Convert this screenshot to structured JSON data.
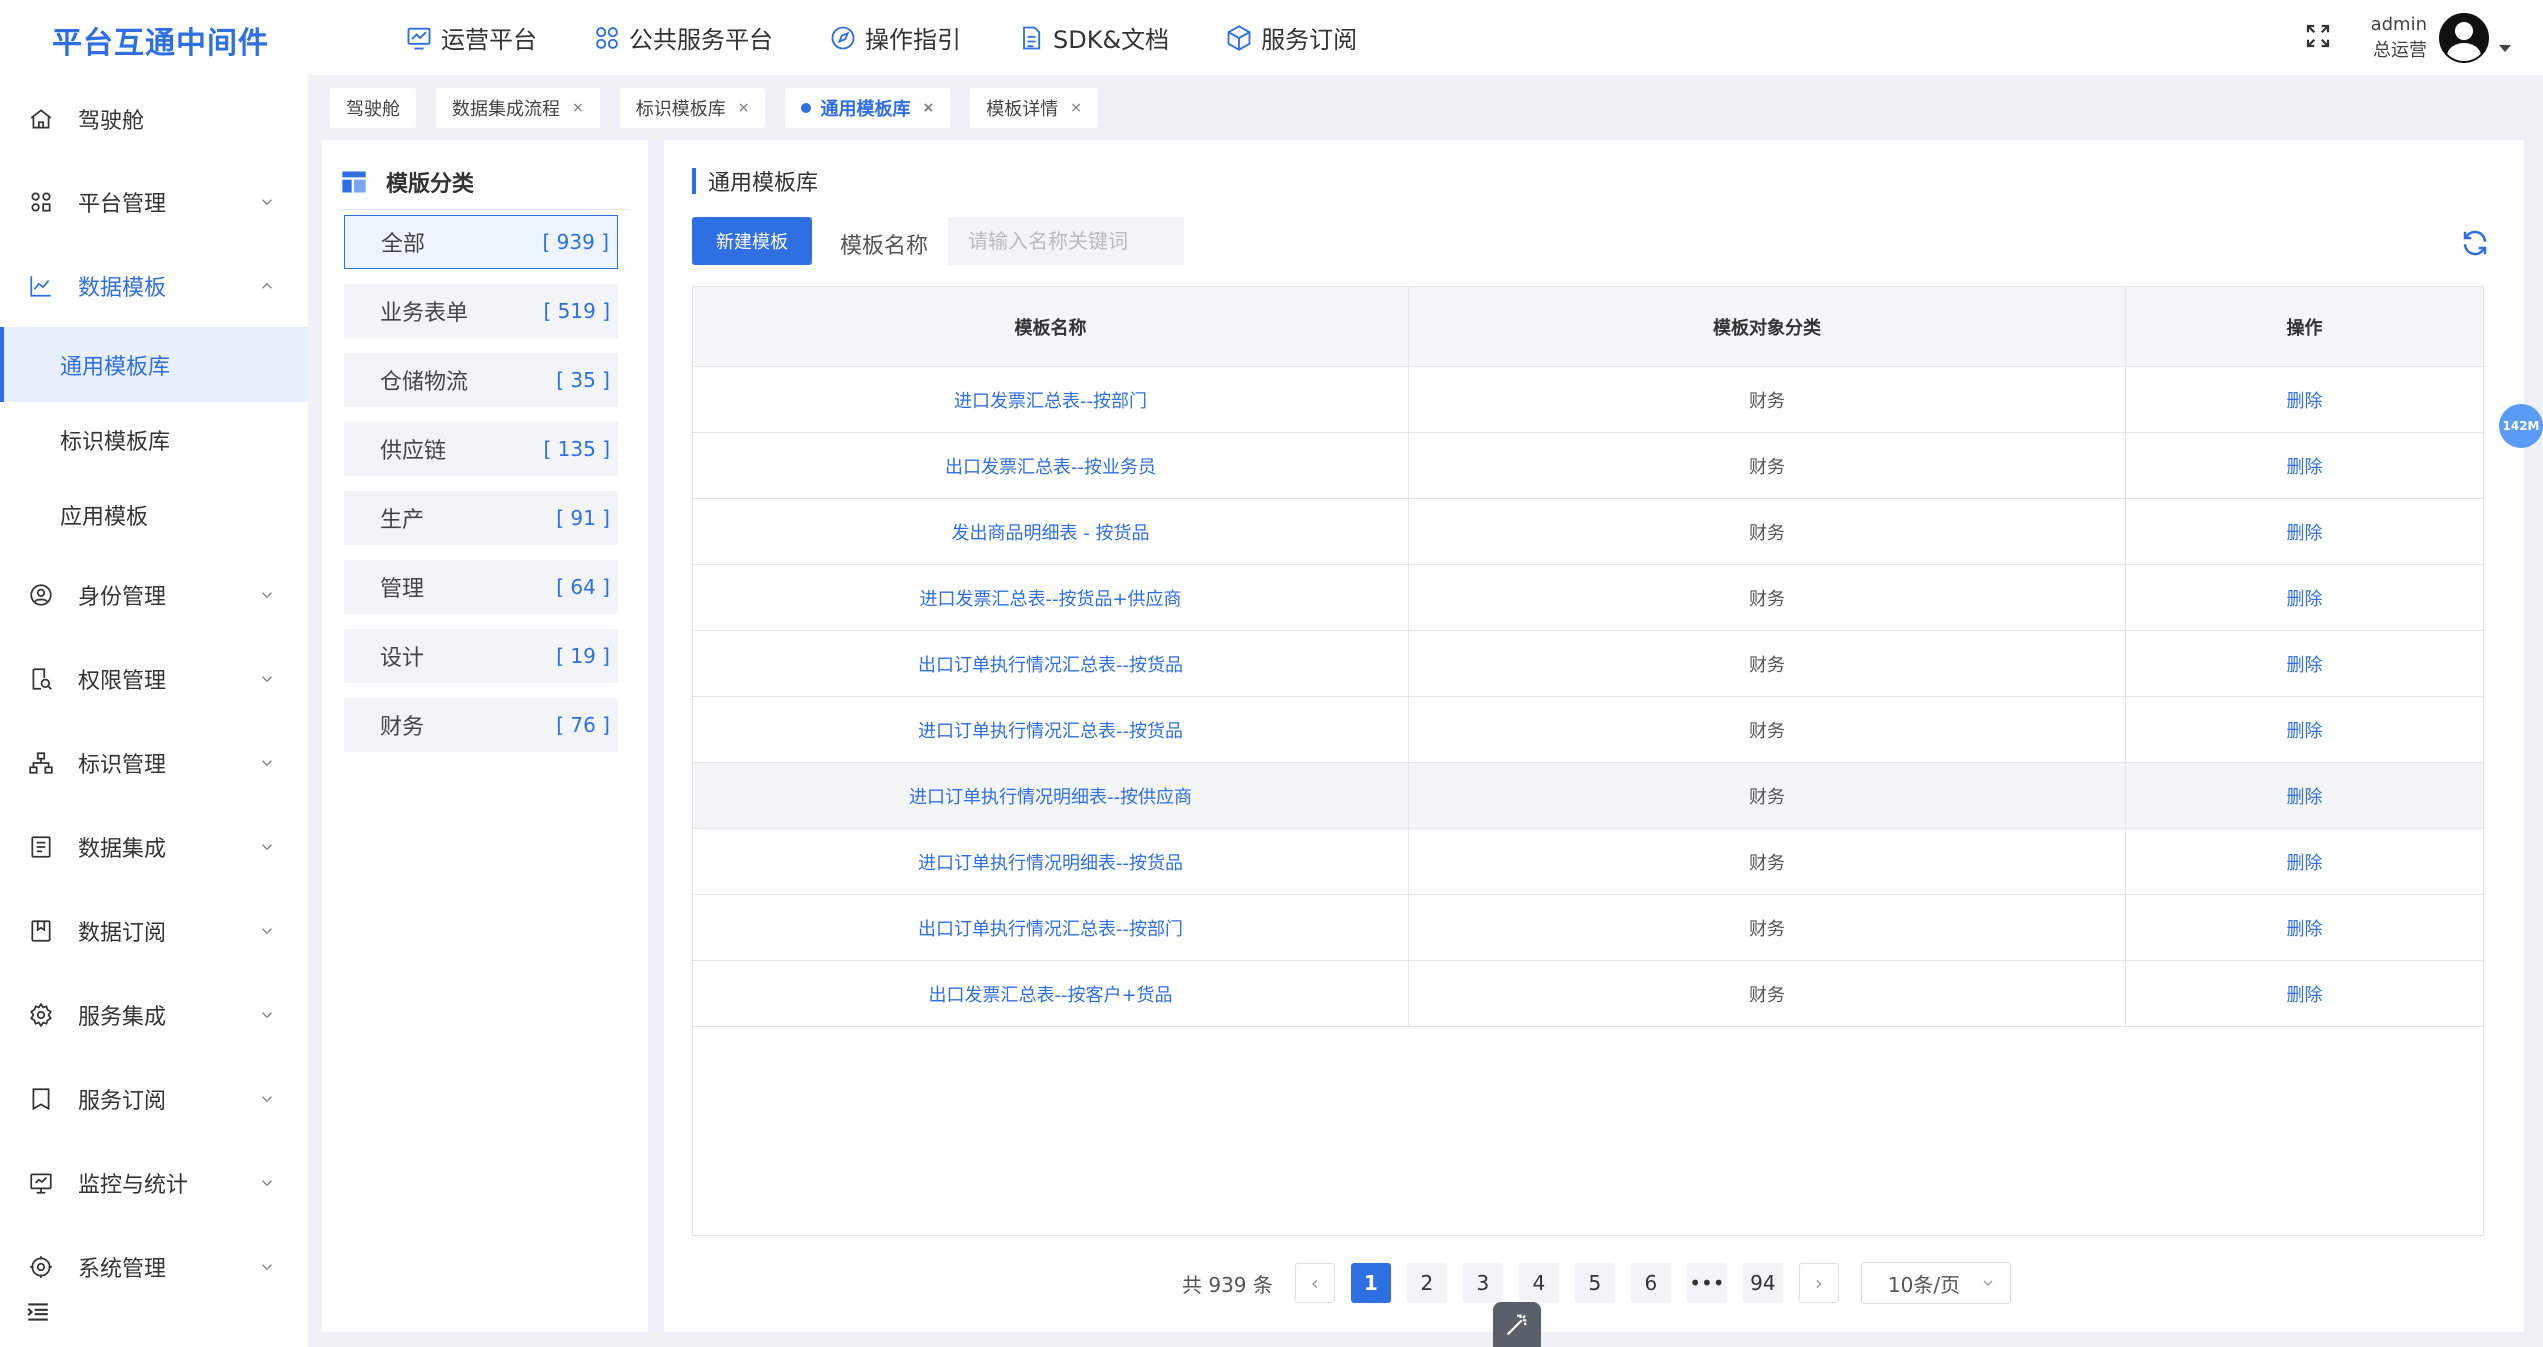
{
  "app": {
    "title": "平台互通中间件"
  },
  "topnav": [
    {
      "label": "运营平台",
      "icon": "monitor-chart-icon"
    },
    {
      "label": "公共服务平台",
      "icon": "grid-icon"
    },
    {
      "label": "操作指引",
      "icon": "compass-icon"
    },
    {
      "label": "SDK&文档",
      "icon": "document-icon"
    },
    {
      "label": "服务订阅",
      "icon": "cube-icon"
    }
  ],
  "user": {
    "name": "admin",
    "role": "总运营"
  },
  "sidebar": {
    "items": [
      {
        "label": "驾驶舱"
      },
      {
        "label": "平台管理"
      },
      {
        "label": "数据模板"
      },
      {
        "label": "身份管理"
      },
      {
        "label": "权限管理"
      },
      {
        "label": "标识管理"
      },
      {
        "label": "数据集成"
      },
      {
        "label": "数据订阅"
      },
      {
        "label": "服务集成"
      },
      {
        "label": "服务订阅"
      },
      {
        "label": "监控与统计"
      },
      {
        "label": "系统管理"
      }
    ],
    "sub": [
      {
        "label": "通用模板库"
      },
      {
        "label": "标识模板库"
      },
      {
        "label": "应用模板"
      }
    ]
  },
  "tabs": [
    {
      "label": "驾驶舱"
    },
    {
      "label": "数据集成流程",
      "close": "×"
    },
    {
      "label": "标识模板库",
      "close": "×"
    },
    {
      "label": "通用模板库",
      "close": "×"
    },
    {
      "label": "模板详情",
      "close": "×"
    }
  ],
  "category": {
    "title": "模版分类",
    "items": [
      {
        "label": "全部",
        "count": "[ 939 ]"
      },
      {
        "label": "业务表单",
        "count": "[ 519 ]"
      },
      {
        "label": "仓储物流",
        "count": "[ 35 ]"
      },
      {
        "label": "供应链",
        "count": "[ 135 ]"
      },
      {
        "label": "生产",
        "count": "[ 91 ]"
      },
      {
        "label": "管理",
        "count": "[ 64 ]"
      },
      {
        "label": "设计",
        "count": "[ 19 ]"
      },
      {
        "label": "财务",
        "count": "[ 76 ]"
      }
    ]
  },
  "main": {
    "title": "通用模板库",
    "new_button": "新建模板",
    "search_label": "模板名称",
    "search_placeholder": "请输入名称关键词",
    "search_value": "",
    "table": {
      "headers": [
        "模板名称",
        "模板对象分类",
        "操作"
      ],
      "rows": [
        {
          "name": "进口发票汇总表--按部门",
          "category": "财务",
          "op": "删除"
        },
        {
          "name": "出口发票汇总表--按业务员",
          "category": "财务",
          "op": "删除"
        },
        {
          "name": "发出商品明细表 - 按货品",
          "category": "财务",
          "op": "删除"
        },
        {
          "name": "进口发票汇总表--按货品+供应商",
          "category": "财务",
          "op": "删除"
        },
        {
          "name": "出口订单执行情况汇总表--按货品",
          "category": "财务",
          "op": "删除"
        },
        {
          "name": "进口订单执行情况汇总表--按货品",
          "category": "财务",
          "op": "删除"
        },
        {
          "name": "进口订单执行情况明细表--按供应商",
          "category": "财务",
          "op": "删除"
        },
        {
          "name": "进口订单执行情况明细表--按货品",
          "category": "财务",
          "op": "删除"
        },
        {
          "name": "出口订单执行情况汇总表--按部门",
          "category": "财务",
          "op": "删除"
        },
        {
          "name": "出口发票汇总表--按客户+货品",
          "category": "财务",
          "op": "删除"
        }
      ]
    }
  },
  "pagination": {
    "total": "共 939 条",
    "prev": "‹",
    "next": "›",
    "pages": [
      "1",
      "2",
      "3",
      "4",
      "5",
      "6",
      "•••",
      "94"
    ],
    "current": "1",
    "page_size": "10条/页"
  },
  "badge": {
    "memory": "142M"
  },
  "colors": {
    "primary": "#2f6fe4",
    "background": "#eef1f6"
  }
}
